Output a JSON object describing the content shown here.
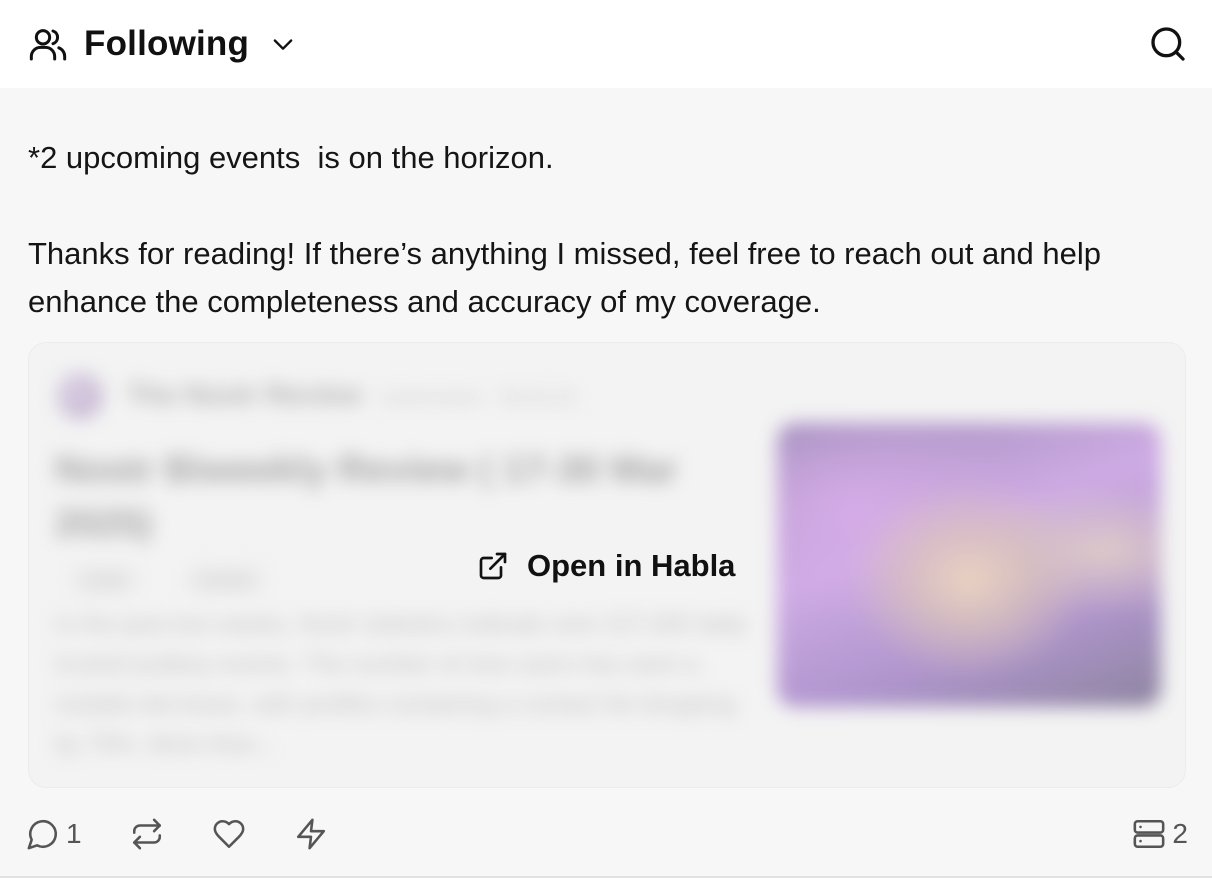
{
  "header": {
    "feed_title": "Following",
    "feed_icon": "users-icon",
    "dropdown_icon": "chevron-down-icon",
    "search_icon": "search-icon"
  },
  "post": {
    "line1": "*2 upcoming events  is on the horizon.",
    "line2": "Thanks for reading! If there’s anything I missed, feel free to reach out and help enhance the completeness and accuracy of my coverage."
  },
  "embed": {
    "author": "The Nostr Review",
    "date": "nostrreview · 30.03.25",
    "title": "Nostr Biweekly Review ( 17-30 Mar 2025)",
    "tags": [
      "nostr",
      "review"
    ],
    "summary": "In the past two weeks, Nostr statistics indicate over 227,000 daily trusted pubkey events. The number of new users has seen a notable decrease, with profiles containing a contact list dropping by 79%. More than...",
    "open_label": "Open in Habla",
    "open_icon": "external-link-icon"
  },
  "actions": {
    "reply_count": "1",
    "relay_count": "2"
  },
  "colors": {
    "background": "#f7f7f7",
    "header_background": "#ffffff",
    "text": "#111111",
    "muted": "#555555"
  }
}
